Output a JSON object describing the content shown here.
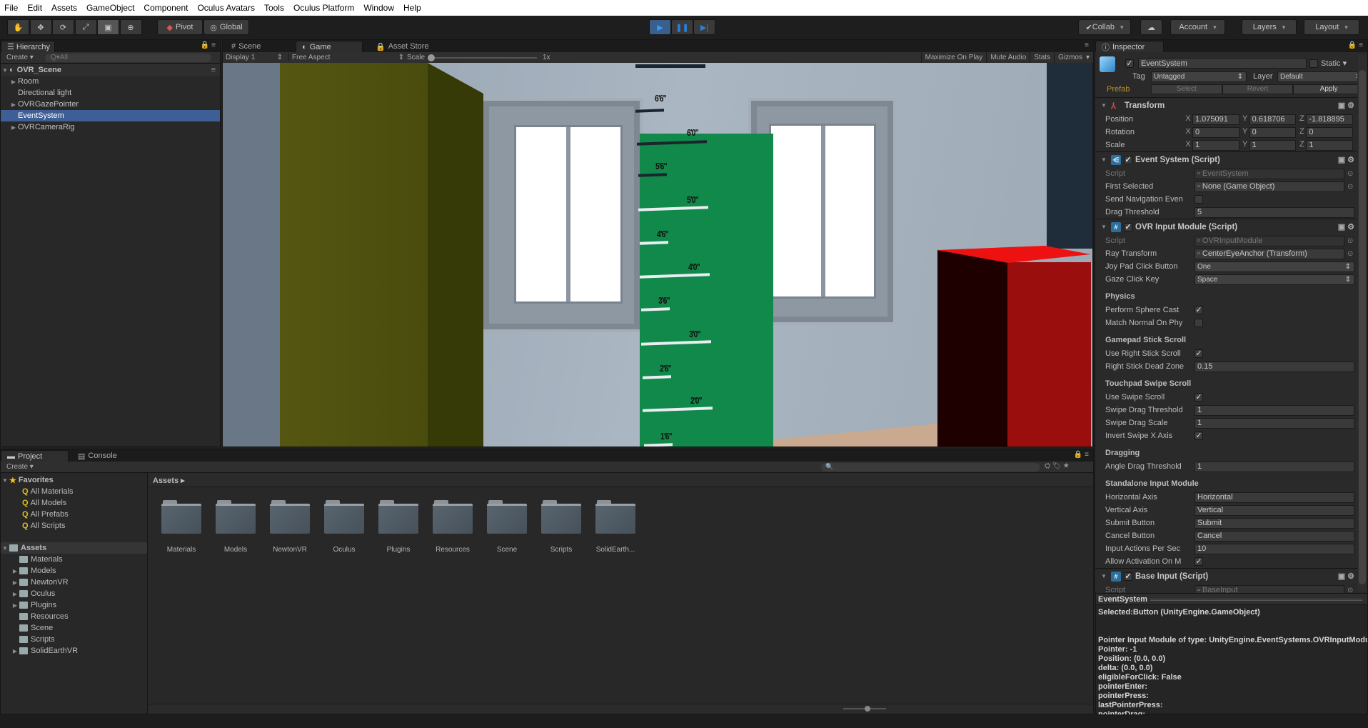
{
  "menu": [
    "File",
    "Edit",
    "Assets",
    "GameObject",
    "Component",
    "Oculus Avatars",
    "Tools",
    "Oculus Platform",
    "Window",
    "Help"
  ],
  "toolbar": {
    "tools": [
      "hand-icon",
      "move-icon",
      "rotate-icon",
      "scale-icon",
      "rect-icon",
      "transform-icon"
    ],
    "pivot": "Pivot",
    "global": "Global",
    "collab": "Collab",
    "account": "Account",
    "layers": "Layers",
    "layout": "Layout",
    "play_color": "#2a7fd8"
  },
  "hierarchy": {
    "tab": "Hierarchy",
    "create": "Create",
    "search_placeholder": "All",
    "scene": "OVR_Scene",
    "items": [
      {
        "label": "Room",
        "expandable": true
      },
      {
        "label": "Directional light",
        "expandable": false
      },
      {
        "label": "OVRGazePointer",
        "expandable": true
      },
      {
        "label": "EventSystem",
        "expandable": false,
        "selected": true
      },
      {
        "label": "OVRCameraRig",
        "expandable": true
      }
    ]
  },
  "game": {
    "tabs": [
      "Scene",
      "Game",
      "Asset Store"
    ],
    "active_tab": "Game",
    "display": "Display 1",
    "aspect": "Free Aspect",
    "scale_label": "Scale",
    "scale_value": "1x",
    "right_buttons": [
      "Maximize On Play",
      "Mute Audio",
      "Stats",
      "Gizmos"
    ],
    "height_labels": [
      "6'6\"",
      "6'0\"",
      "5'6\"",
      "5'0\"",
      "4'6\"",
      "4'0\"",
      "3'6\"",
      "3'0\"",
      "2'6\"",
      "2'0\"",
      "1'6\""
    ]
  },
  "project": {
    "tabs": [
      "Project",
      "Console"
    ],
    "create": "Create",
    "favorites_label": "Favorites",
    "favorites": [
      "All Materials",
      "All Models",
      "All Prefabs",
      "All Scripts"
    ],
    "assets_label": "Assets",
    "tree": [
      {
        "label": "Materials",
        "expandable": false
      },
      {
        "label": "Models",
        "expandable": true
      },
      {
        "label": "NewtonVR",
        "expandable": true
      },
      {
        "label": "Oculus",
        "expandable": true
      },
      {
        "label": "Plugins",
        "expandable": true
      },
      {
        "label": "Resources",
        "expandable": false
      },
      {
        "label": "Scene",
        "expandable": false
      },
      {
        "label": "Scripts",
        "expandable": false
      },
      {
        "label": "SolidEarthVR",
        "expandable": true
      }
    ],
    "breadcrumb": "Assets",
    "folders": [
      "Materials",
      "Models",
      "NewtonVR",
      "Oculus",
      "Plugins",
      "Resources",
      "Scene",
      "Scripts",
      "SolidEarth..."
    ]
  },
  "inspector": {
    "tab": "Inspector",
    "object": {
      "name": "EventSystem",
      "enabled": true,
      "static_label": "Static",
      "tag_label": "Tag",
      "tag": "Untagged",
      "layer_label": "Layer",
      "layer": "Default",
      "prefab_label": "Prefab",
      "prefab_buttons": [
        "Select",
        "Revert",
        "Apply"
      ]
    },
    "transform": {
      "title": "Transform",
      "rows": [
        {
          "label": "Position",
          "x": "1.075091",
          "y": "0.618706",
          "z": "-1.818895"
        },
        {
          "label": "Rotation",
          "x": "0",
          "y": "0",
          "z": "0"
        },
        {
          "label": "Scale",
          "x": "1",
          "y": "1",
          "z": "1"
        }
      ]
    },
    "components": [
      {
        "title": "Event System (Script)",
        "rows": [
          {
            "label": "Script",
            "type": "script",
            "value": "EventSystem"
          },
          {
            "label": "First Selected",
            "type": "object",
            "value": "None (Game Object)"
          },
          {
            "label": "Send Navigation Even",
            "type": "check",
            "value": false
          },
          {
            "label": "Drag Threshold",
            "type": "text",
            "value": "5"
          }
        ]
      },
      {
        "title": "OVR Input Module (Script)",
        "rows": [
          {
            "label": "Script",
            "type": "script",
            "value": "OVRInputModule"
          },
          {
            "label": "Ray Transform",
            "type": "object",
            "value": "CenterEyeAnchor (Transform)"
          },
          {
            "label": "Joy Pad Click Button",
            "type": "dropdown",
            "value": "One"
          },
          {
            "label": "Gaze Click Key",
            "type": "dropdown",
            "value": "Space"
          },
          {
            "type": "section",
            "label": "Physics"
          },
          {
            "label": "Perform Sphere Cast",
            "type": "check",
            "value": true
          },
          {
            "label": "Match Normal On Phy",
            "type": "check",
            "value": false
          },
          {
            "type": "section",
            "label": "Gamepad Stick Scroll"
          },
          {
            "label": "Use Right Stick Scroll",
            "type": "check",
            "value": true
          },
          {
            "label": "Right Stick Dead Zone",
            "type": "text",
            "value": "0.15"
          },
          {
            "type": "section",
            "label": "Touchpad Swipe Scroll"
          },
          {
            "label": "Use Swipe Scroll",
            "type": "check",
            "value": true
          },
          {
            "label": "Swipe Drag Threshold",
            "type": "text",
            "value": "1"
          },
          {
            "label": "Swipe Drag Scale",
            "type": "text",
            "value": "1"
          },
          {
            "label": "Invert Swipe X Axis",
            "type": "check",
            "value": true
          },
          {
            "type": "section",
            "label": "Dragging"
          },
          {
            "label": "Angle Drag Threshold",
            "type": "text",
            "value": "1"
          },
          {
            "type": "section",
            "label": "Standalone Input Module"
          },
          {
            "label": "Horizontal Axis",
            "type": "text",
            "value": "Horizontal"
          },
          {
            "label": "Vertical Axis",
            "type": "text",
            "value": "Vertical"
          },
          {
            "label": "Submit Button",
            "type": "text",
            "value": "Submit"
          },
          {
            "label": "Cancel Button",
            "type": "text",
            "value": "Cancel"
          },
          {
            "label": "Input Actions Per Sec",
            "type": "text",
            "value": "10"
          },
          {
            "label": "Allow Activation On M",
            "type": "check",
            "value": true
          }
        ]
      },
      {
        "title": "Base Input (Script)",
        "rows": [
          {
            "label": "Script",
            "type": "script",
            "value": "BaseInput"
          }
        ]
      }
    ]
  },
  "console_preview": {
    "title": "EventSystem",
    "lines": [
      "Selected:Button (UnityEngine.GameObject)",
      "",
      "",
      "Pointer Input Module of type: UnityEngine.EventSystems.OVRInputModule",
      "Pointer: -1",
      "Position: (0.0, 0.0)",
      "delta: (0.0, 0.0)",
      "eligibleForClick: False",
      "pointerEnter:",
      "pointerPress:",
      "lastPointerPress:",
      "pointerDrag:"
    ]
  }
}
